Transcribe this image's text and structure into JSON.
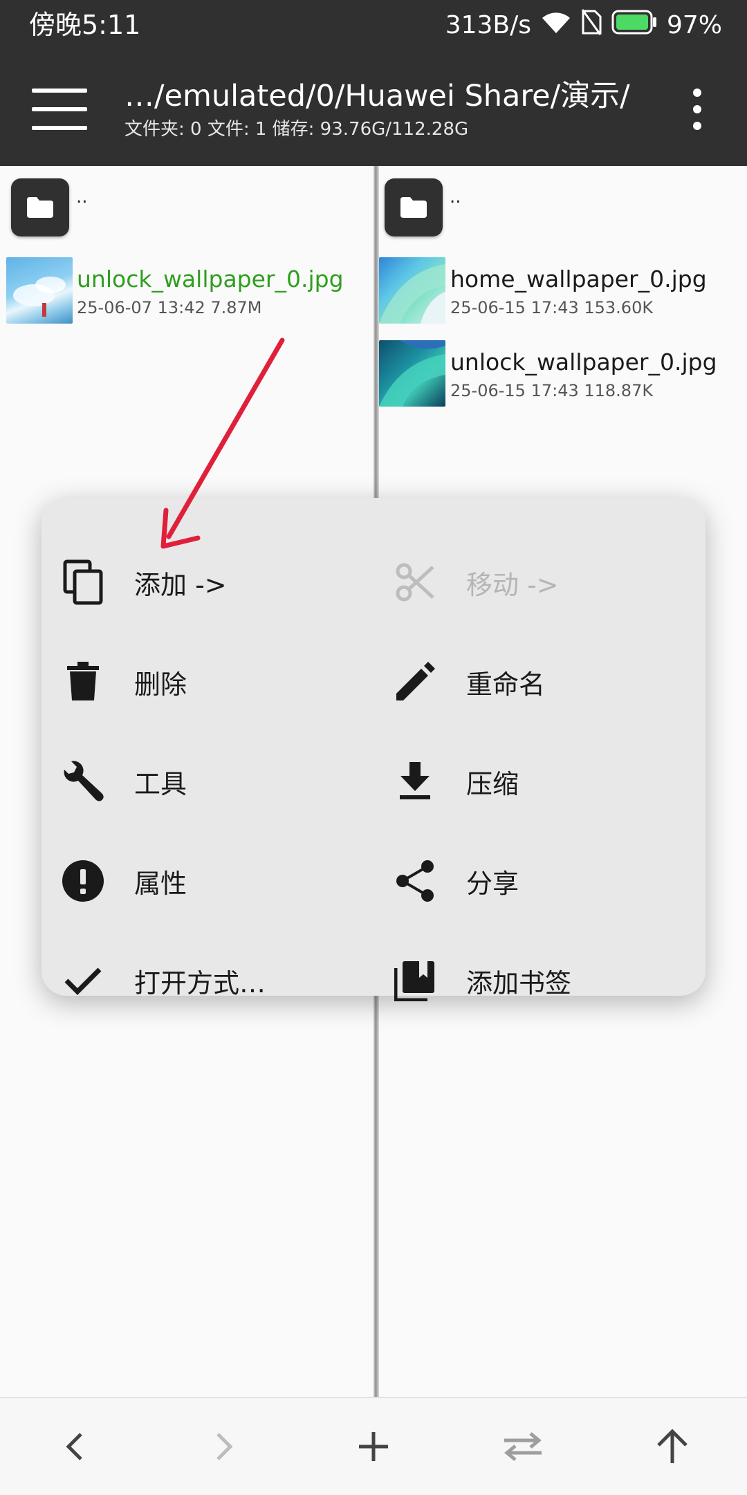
{
  "status_bar": {
    "time": "傍晚5:11",
    "net_speed": "313B/s",
    "battery": "97%",
    "icons": [
      "wifi-icon",
      "no-sim-icon",
      "battery-icon"
    ]
  },
  "app_bar": {
    "path": "…/emulated/0/Huawei Share/演示/",
    "summary": "文件夹: 0  文件: 1  储存: 93.76G/112.28G",
    "icons": [
      "hamburger-menu-icon",
      "more-vert-icon"
    ]
  },
  "left_pane": {
    "parent_label": "..",
    "files": [
      {
        "name": "unlock_wallpaper_0.jpg",
        "meta": "25-06-07 13:42  7.87M",
        "selected": true
      }
    ]
  },
  "right_pane": {
    "parent_label": "..",
    "files": [
      {
        "name": "home_wallpaper_0.jpg",
        "meta": "25-06-15 17:43  153.60K"
      },
      {
        "name": "unlock_wallpaper_0.jpg",
        "meta": "25-06-15 17:43  118.87K"
      }
    ]
  },
  "context_menu": {
    "items": [
      {
        "label": "添加 ->",
        "icon": "copy-icon",
        "enabled": true
      },
      {
        "label": "移动 ->",
        "icon": "scissors-icon",
        "enabled": false
      },
      {
        "label": "删除",
        "icon": "trash-icon",
        "enabled": true
      },
      {
        "label": "重命名",
        "icon": "pencil-icon",
        "enabled": true
      },
      {
        "label": "工具",
        "icon": "wrench-icon",
        "enabled": true
      },
      {
        "label": "压缩",
        "icon": "download-icon",
        "enabled": true
      },
      {
        "label": "属性",
        "icon": "info-icon",
        "enabled": true
      },
      {
        "label": "分享",
        "icon": "share-icon",
        "enabled": true
      },
      {
        "label": "打开方式…",
        "icon": "check-icon",
        "enabled": true
      },
      {
        "label": "添加书签",
        "icon": "bookmark-icon",
        "enabled": true
      }
    ]
  },
  "bottom_bar": {
    "icons": [
      "back-icon",
      "forward-icon",
      "add-icon",
      "swap-icon",
      "up-icon"
    ]
  },
  "colors": {
    "app_bar": "#303030",
    "selected_file": "#2e9e1e",
    "annotation_arrow": "#e0203a",
    "menu_background": "#e8e8e8"
  }
}
